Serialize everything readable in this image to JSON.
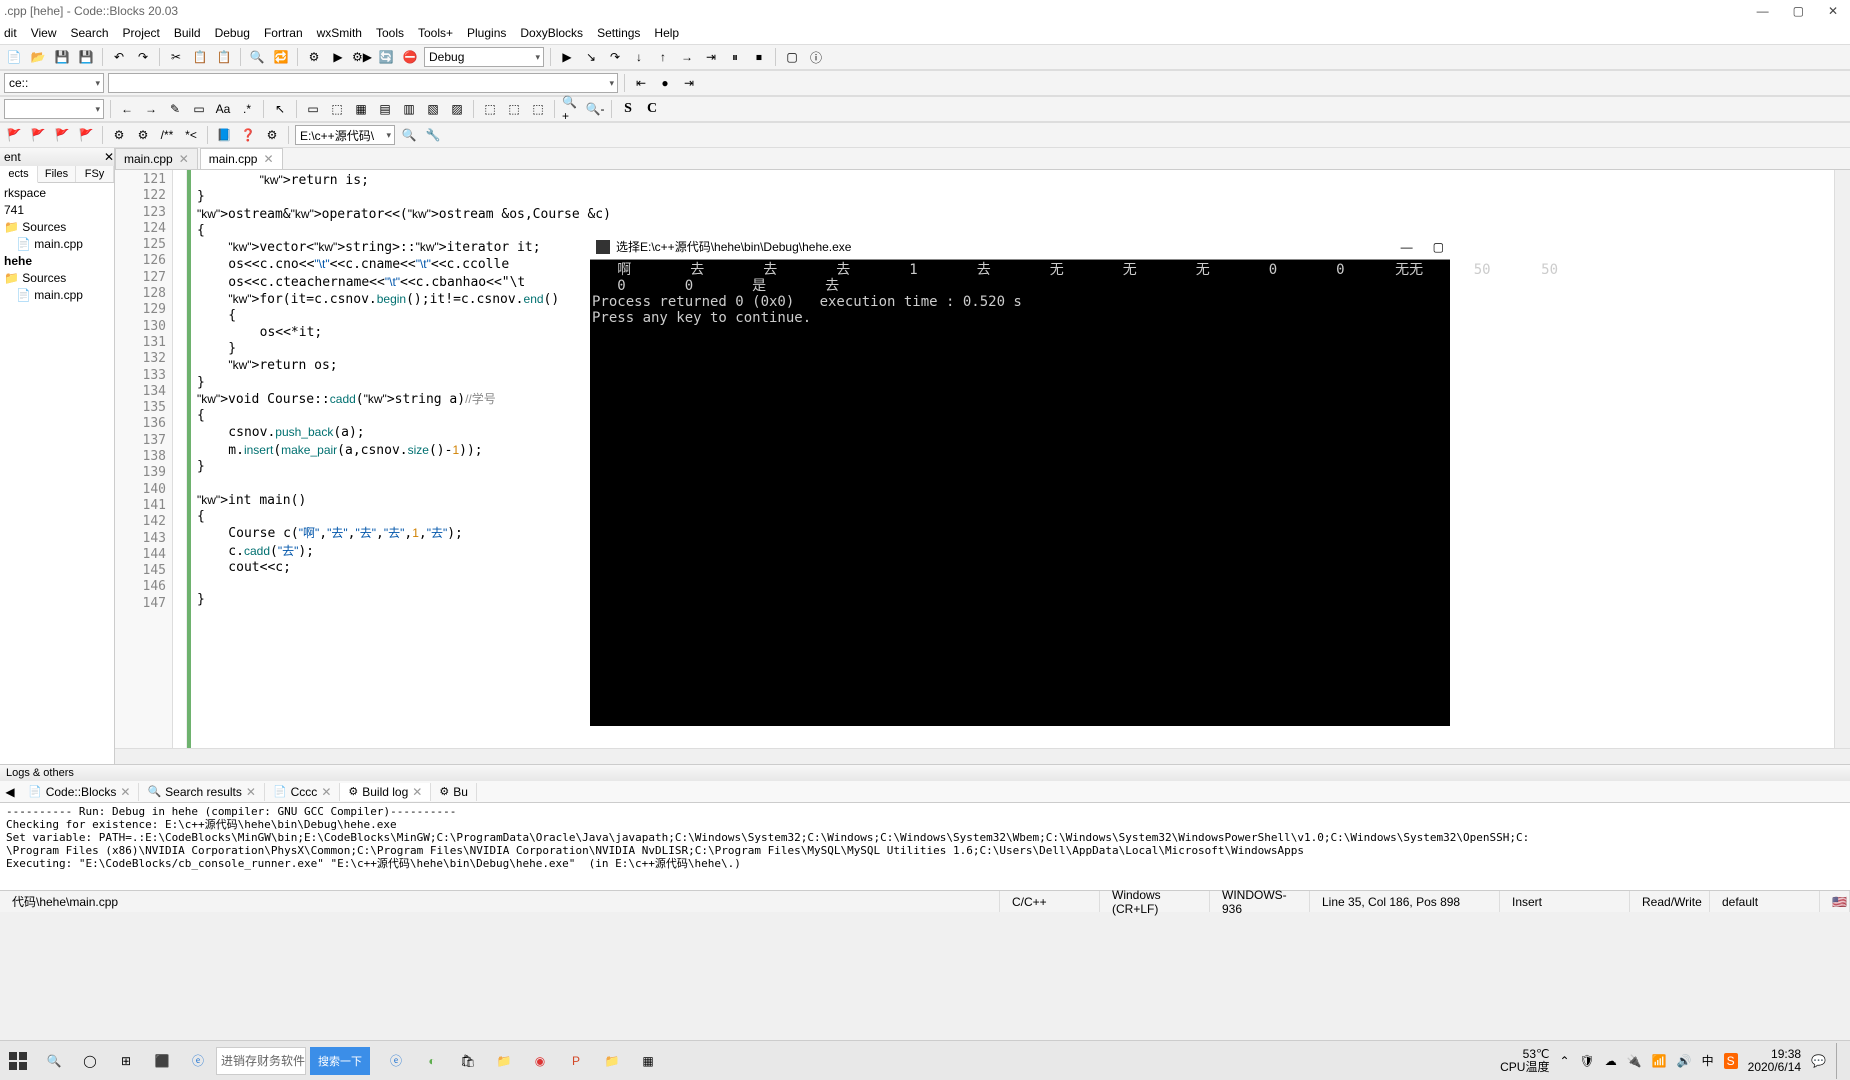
{
  "window": {
    "title": ".cpp [hehe] - Code::Blocks 20.03"
  },
  "menubar": [
    "dit",
    "View",
    "Search",
    "Project",
    "Build",
    "Debug",
    "Fortran",
    "wxSmith",
    "Tools",
    "Tools+",
    "Plugins",
    "DoxyBlocks",
    "Settings",
    "Help"
  ],
  "toolbar": {
    "build_target": "Debug",
    "space_label": "ce::",
    "path_dropdown": "E:\\c++源代码\\"
  },
  "sidebar": {
    "pane_title": "ent",
    "tabs": [
      "ects",
      "Files",
      "FSy"
    ],
    "tree": [
      {
        "type": "label",
        "text": "rkspace"
      },
      {
        "type": "label",
        "text": "741"
      },
      {
        "type": "folder",
        "text": "Sources",
        "indent": 0
      },
      {
        "type": "file",
        "text": "main.cpp",
        "indent": 1
      },
      {
        "type": "proj",
        "text": "hehe",
        "indent": 0
      },
      {
        "type": "folder",
        "text": "Sources",
        "indent": 0
      },
      {
        "type": "file",
        "text": "main.cpp",
        "indent": 1
      }
    ]
  },
  "editor_tabs": [
    {
      "label": "main.cpp",
      "active": false
    },
    {
      "label": "main.cpp",
      "active": true
    }
  ],
  "code": {
    "first_line": 121,
    "lines": [
      "        return is;",
      "}",
      "ostream&operator<<(ostream &os,Course &c)",
      "{",
      "    vector<string>::iterator it;",
      "    os<<c.cno<<\"\\t\"<<c.cname<<\"\\t\"<<c.ccolle",
      "    os<<c.cteachername<<\"\\t\"<<c.cbanhao<<\"\\t",
      "    for(it=c.csnov.begin();it!=c.csnov.end()",
      "    {",
      "        os<<*it;",
      "    }",
      "    return os;",
      "}",
      "void Course::cadd(string a)//学号",
      "{",
      "    csnov.push_back(a);",
      "    m.insert(make_pair(a,csnov.size()-1));",
      "}",
      "",
      "int main()",
      "{",
      "    Course c(\"啊\",\"去\",\"去\",\"去\",1,\"去\");",
      "    c.cadd(\"去\");",
      "    cout<<c;",
      "",
      "}",
      ""
    ]
  },
  "console": {
    "title": "选择E:\\c++源代码\\hehe\\bin\\Debug\\hehe.exe",
    "row_labels": [
      "啊",
      "去",
      "去",
      "去",
      "1",
      "去",
      "无",
      "无",
      "无",
      "0",
      "0",
      "无无",
      "50",
      "50"
    ],
    "row2_labels": [
      "0",
      "0",
      "是",
      "去"
    ],
    "proc_line": "Process returned 0 (0x0)   execution time : 0.520 s",
    "press_line": "Press any key to continue."
  },
  "logs": {
    "header": "Logs & others",
    "tabs": [
      {
        "label": "Code::Blocks",
        "active": false
      },
      {
        "label": "Search results",
        "active": false
      },
      {
        "label": "Cccc",
        "active": false
      },
      {
        "label": "Build log",
        "active": true
      },
      {
        "label": "Bu",
        "active": false
      }
    ],
    "body": "---------- Run: Debug in hehe (compiler: GNU GCC Compiler)----------\nChecking for existence: E:\\c++源代码\\hehe\\bin\\Debug\\hehe.exe\nSet variable: PATH=.:E:\\CodeBlocks\\MinGW\\bin;E:\\CodeBlocks\\MinGW;C:\\ProgramData\\Oracle\\Java\\javapath;C:\\Windows\\System32;C:\\Windows;C:\\Windows\\System32\\Wbem;C:\\Windows\\System32\\WindowsPowerShell\\v1.0;C:\\Windows\\System32\\OpenSSH;C:\n\\Program Files (x86)\\NVIDIA Corporation\\PhysX\\Common;C:\\Program Files\\NVIDIA Corporation\\NVIDIA NvDLISR;C:\\Program Files\\MySQL\\MySQL Utilities 1.6;C:\\Users\\Dell\\AppData\\Local\\Microsoft\\WindowsApps\nExecuting: \"E:\\CodeBlocks/cb_console_runner.exe\" \"E:\\c++源代码\\hehe\\bin\\Debug\\hehe.exe\"  (in E:\\c++源代码\\hehe\\.)"
  },
  "statusbar": {
    "filepath": "代码\\hehe\\main.cpp",
    "language": "C/C++",
    "eol": "Windows (CR+LF)",
    "encoding": "WINDOWS-936",
    "cursor": "Line 35, Col 186, Pos 898",
    "insert": "Insert",
    "rw": "Read/Write",
    "profile": "default"
  },
  "taskbar": {
    "search_placeholder": "进销存财务软件",
    "search_button": "搜索一下",
    "temp": "53℃",
    "temp_label": "CPU温度",
    "time": "19:38",
    "date": "2020/6/14"
  }
}
